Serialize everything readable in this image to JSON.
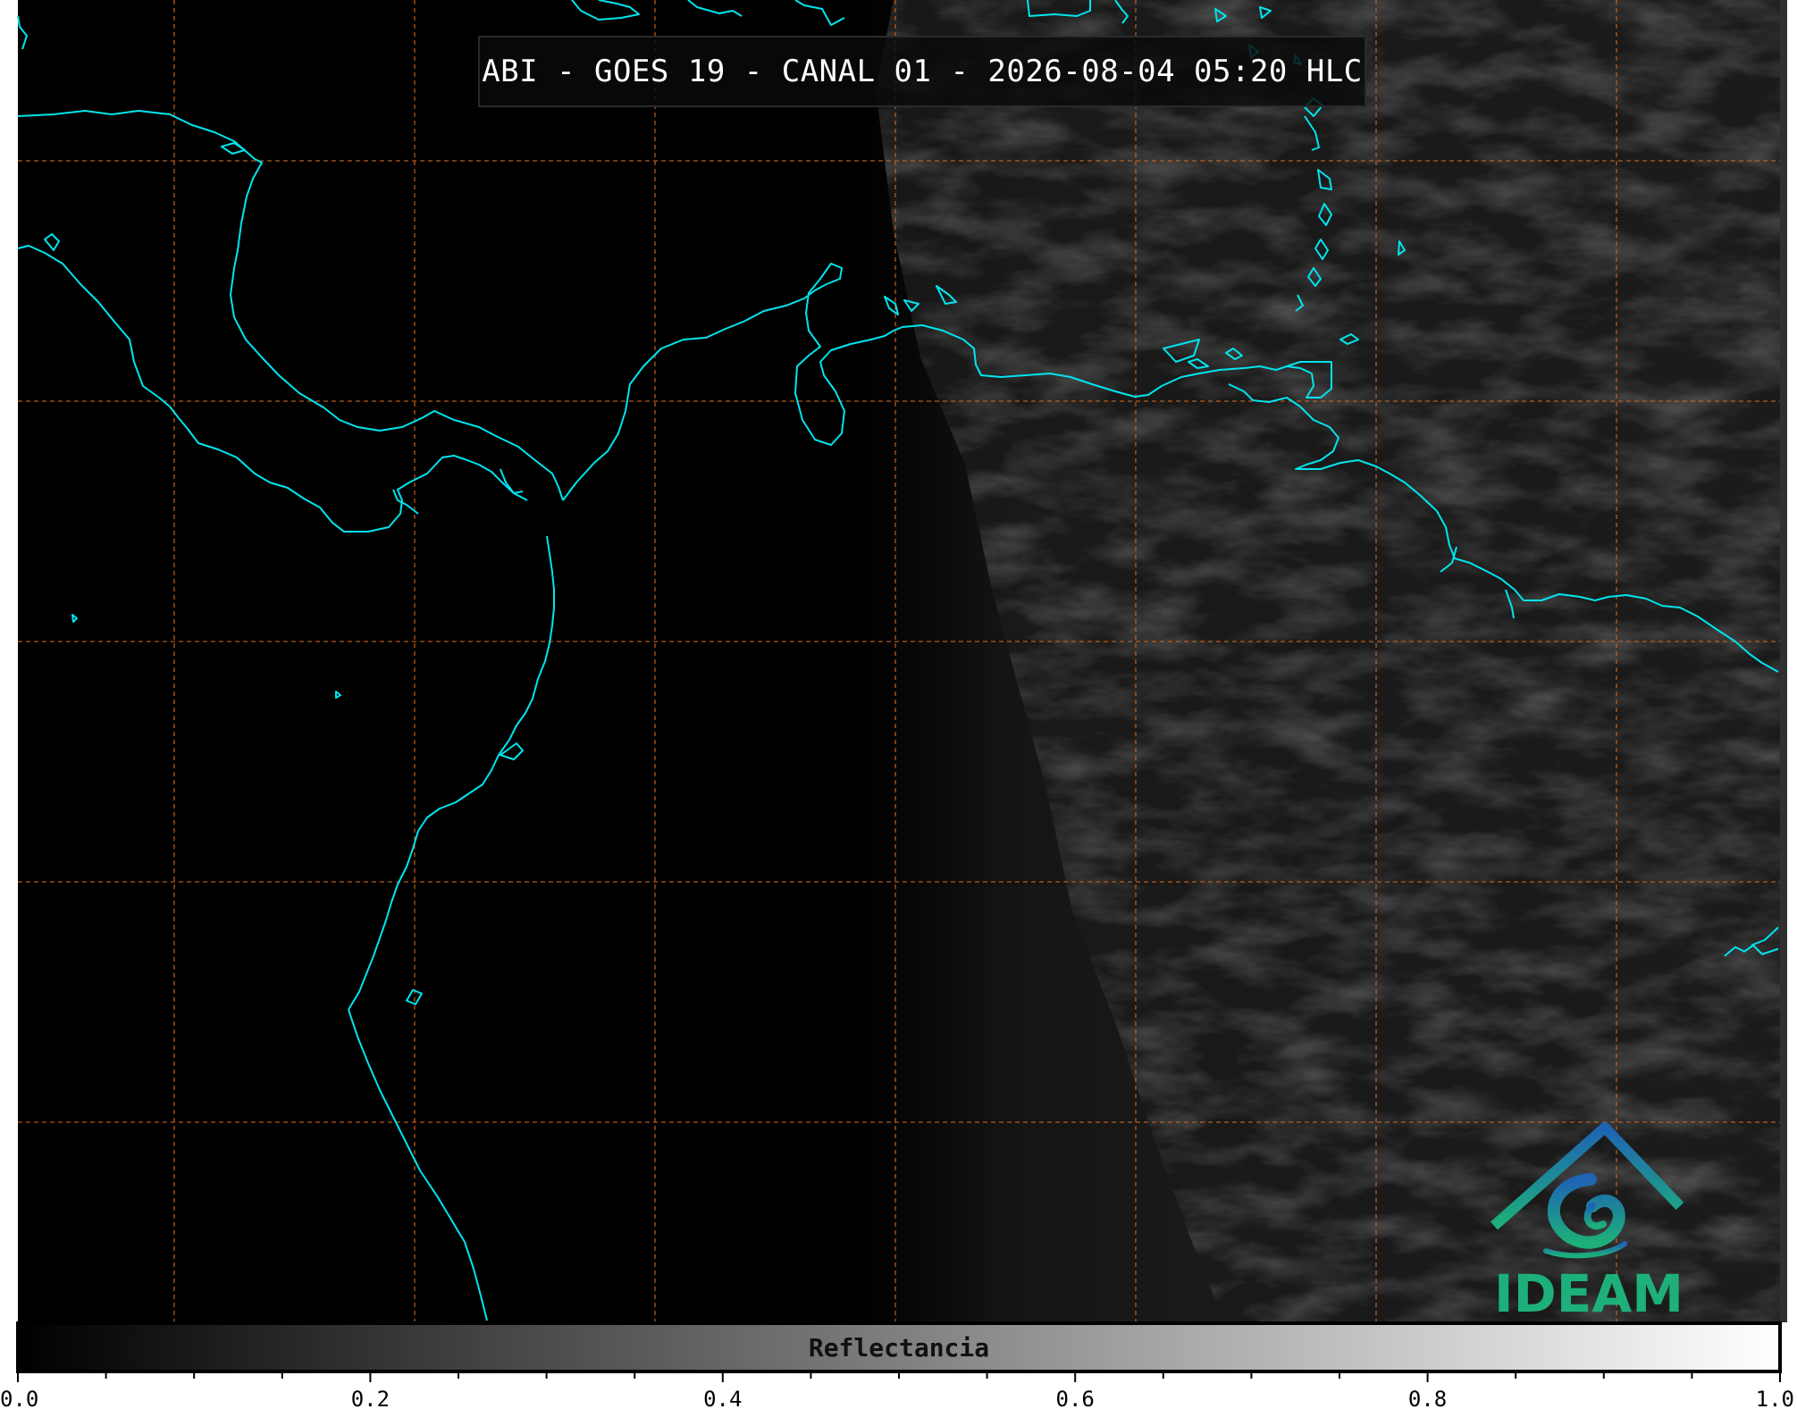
{
  "map": {
    "title": "ABI - GOES 19 - CANAL 01 - 2026-08-04 05:20 HLC",
    "coastline_color": "#00E5EE",
    "grid_color": "#C8641E",
    "background_color": "#000000",
    "imagery": "grayscale visible reflectance; night-side dark on left, faint cloud texture on right"
  },
  "colorbar": {
    "label": "Reflectancia",
    "ticks": [
      "0.0",
      "0.2",
      "0.4",
      "0.6",
      "0.8",
      "1.0"
    ],
    "range": [
      0.0,
      1.0
    ],
    "colormap": "grayscale black to white"
  },
  "logo": {
    "text": "IDEAM",
    "color_top": "#1E63B4",
    "color_bottom": "#1DB07A"
  }
}
